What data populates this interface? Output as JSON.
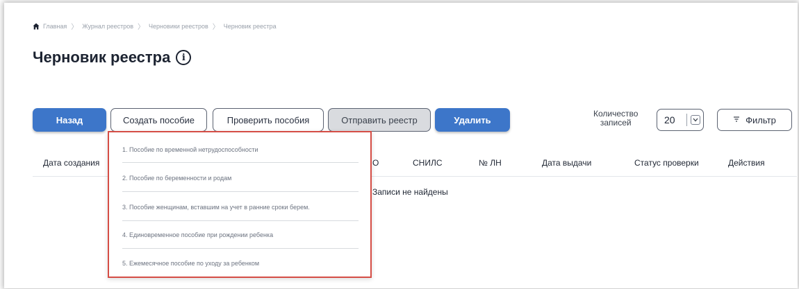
{
  "breadcrumb": {
    "items": [
      "Главная",
      "Журнал реестров",
      "Черновики реестров",
      "Черновик реестра"
    ]
  },
  "page": {
    "title": "Черновик реестра"
  },
  "toolbar": {
    "back_label": "Назад",
    "create_label": "Создать пособие",
    "check_label": "Проверить пособия",
    "send_label": "Отправить реестр",
    "delete_label": "Удалить",
    "count_label_line1": "Количество",
    "count_label_line2": "записей",
    "count_value": "20",
    "filter_label": "Фильтр"
  },
  "table": {
    "columns": [
      "Дата создания",
      "О",
      "СНИЛС",
      "№ ЛН",
      "Дата выдачи",
      "Статус проверки",
      "Действия"
    ],
    "empty_message": "Записи не найдены"
  },
  "dropdown": {
    "items": [
      "1. Пособие по временной нетрудоспособности",
      "2. Пособие по беременности и родам",
      "3. Пособие женщинам, вставшим на учет в ранние сроки берем.",
      "4. Единовременное пособие при рождении ребенка",
      "5. Ежемесячное пособие по уходу за ребенком"
    ]
  },
  "colors": {
    "primary": "#3d76c9",
    "highlight_border": "#d54d45",
    "disabled_button": "#d9dbdf"
  },
  "icons": {
    "home": "home-icon",
    "info": "info-icon",
    "chevron": "chevron-down-icon",
    "filter": "filter-icon"
  }
}
